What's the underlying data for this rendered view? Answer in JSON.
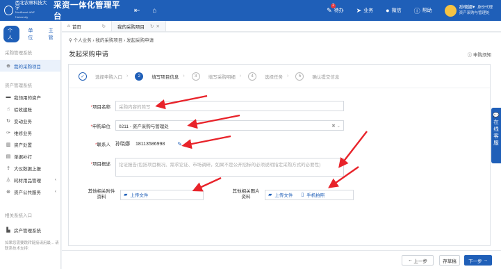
{
  "header": {
    "school_name": "西北农林科技大学",
    "school_name_en": "Northwest A&F University",
    "app_title": "采资一体化管理平台",
    "nav": [
      {
        "label": "待办",
        "icon": "edit-icon",
        "badge": "2"
      },
      {
        "label": "业务",
        "icon": "send-icon"
      },
      {
        "label": "微信",
        "icon": "wechat-icon"
      },
      {
        "label": "帮助",
        "icon": "help-icon"
      }
    ],
    "user_name": "孙晓娜",
    "user_identity": "身份代理",
    "user_dept": "资产采购与管理处"
  },
  "sidebar": {
    "tabs": [
      "个人",
      "单位",
      "主管"
    ],
    "group1": "采购管理系统",
    "group1_items": [
      "我的采购项目"
    ],
    "group2": "资产管理系统",
    "group2_items": [
      "我领用的资产",
      "验收建账",
      "变动业务",
      "维修业务",
      "资产处置",
      "单据补打",
      "大仪数据上报",
      "耗材用品管理",
      "资产公共服务"
    ],
    "group3": "相关系统入口",
    "group3_items": [
      "房产管理系统"
    ],
    "hint": "如果您需要跳转链接请用最... 请联系技术支持:"
  },
  "page_tabs": {
    "home": "首页",
    "current": "我的采购项目"
  },
  "breadcrumb": "个人业务 › 我的采购项目 › 发起采购申请",
  "page_title": "发起采购申请",
  "help_link": "申购须知",
  "steps": [
    {
      "num": "✓",
      "label": "选择申购入口"
    },
    {
      "num": "2",
      "label": "填写项目信息"
    },
    {
      "num": "3",
      "label": "填写采购明细"
    },
    {
      "num": "4",
      "label": "选择任务"
    },
    {
      "num": "5",
      "label": "确认提交信息"
    }
  ],
  "form": {
    "project_name_label": "项目名称",
    "project_name_placeholder": "采购内容的简写",
    "applicant_unit_label": "申购单位",
    "applicant_unit_value": "0211 - 资产采购与管理处",
    "contact_label": "联系人",
    "contact_name": "孙晓娜",
    "contact_phone": "18113586998",
    "overview_label": "项目概述",
    "overview_placeholder": "论证报告(包括项目概况、需求论证、市场调研，如果不是公开招标的必须说明指定采购方式的必要性)",
    "attach_label": "其他相关附件资料",
    "image_label": "其他相关图片资料",
    "upload_file": "上传文件",
    "phone_shot": "手机拍照"
  },
  "footer": {
    "prev": "上一步",
    "draft": "存草稿",
    "next": "下一步"
  },
  "side_service": "在线客服",
  "colors": {
    "primary": "#1f5fb8",
    "required": "#e6393e",
    "arrow": "#e8232a"
  }
}
